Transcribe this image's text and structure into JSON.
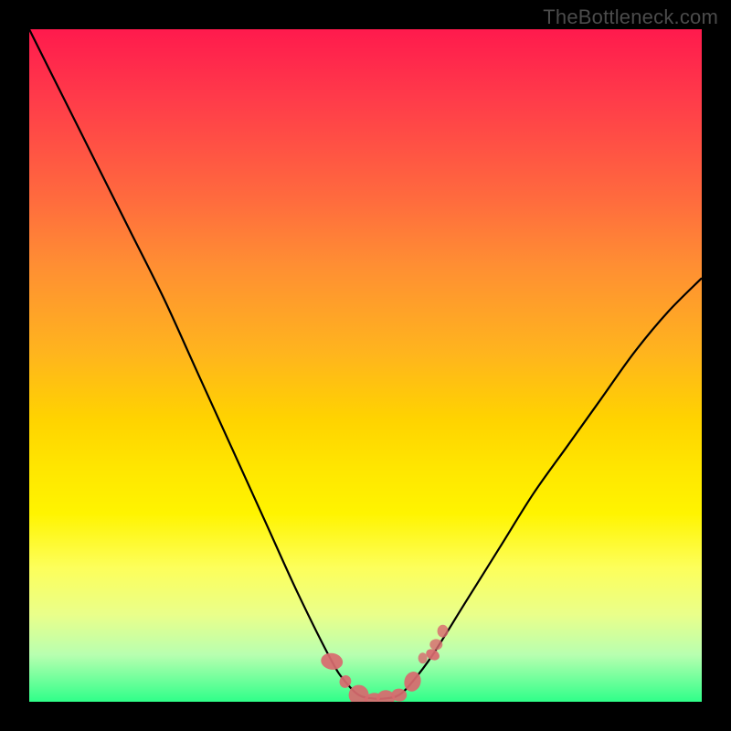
{
  "watermark": {
    "text": "TheBottleneck.com"
  },
  "chart_data": {
    "type": "line",
    "title": "",
    "xlabel": "",
    "ylabel": "",
    "xlim": [
      0,
      100
    ],
    "ylim": [
      0,
      100
    ],
    "x": [
      0,
      5,
      10,
      15,
      20,
      25,
      30,
      35,
      40,
      45,
      47,
      49,
      51,
      53,
      55,
      57,
      60,
      65,
      70,
      75,
      80,
      85,
      90,
      95,
      100
    ],
    "y": [
      100,
      90,
      80,
      70,
      60,
      49,
      38,
      27,
      16,
      6,
      3,
      1,
      0.5,
      0.5,
      1,
      3,
      7,
      15,
      23,
      31,
      38,
      45,
      52,
      58,
      63
    ],
    "markers_segment_index_range": [
      9,
      16
    ],
    "marker_color": "#d86a6f",
    "line_color": "#000000"
  }
}
